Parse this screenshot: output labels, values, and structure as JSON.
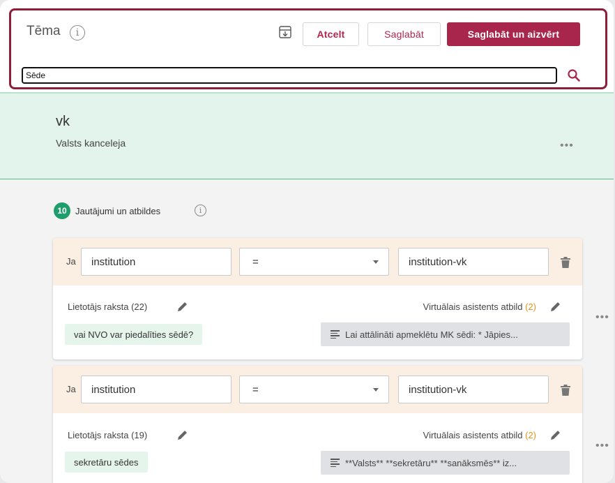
{
  "header": {
    "title": "Tēma",
    "cancel_label": "Atcelt",
    "save_label": "Saglabāt",
    "save_close_label": "Saglabāt un aizvērt"
  },
  "search": {
    "value": "Sēde"
  },
  "topic": {
    "code": "vk",
    "name": "Valsts kanceleja"
  },
  "qa": {
    "count": "10",
    "label": "Jautājumi un atbildes"
  },
  "cards": [
    {
      "prefix": "Ja",
      "field": "institution",
      "operator": "=",
      "value": "institution-vk",
      "user_label": "Lietotājs raksta",
      "user_count": "(22)",
      "assistant_label": "Virtuālais asistents atbild",
      "assistant_count": "(2)",
      "example": "vai NVO var piedalīties sēdē?",
      "answer": "Lai attālināti apmeklētu MK sēdi: * Jāpies..."
    },
    {
      "prefix": "Ja",
      "field": "institution",
      "operator": "=",
      "value": "institution-vk",
      "user_label": "Lietotājs raksta",
      "user_count": "(19)",
      "assistant_label": "Virtuālais asistents atbild",
      "assistant_count": "(2)",
      "example": "sekretāru sēdes",
      "answer": "**Valsts** **sekretāru** **sanāksmēs** iz..."
    }
  ],
  "icons": [
    "info-icon",
    "archive-icon",
    "search-icon",
    "more-icon",
    "dropdown-caret-icon",
    "trash-icon",
    "pencil-icon",
    "text-lines-icon"
  ],
  "colors": {
    "brand": "#a8254b",
    "green": "#1f9d6b",
    "orange": "#e0921a"
  }
}
